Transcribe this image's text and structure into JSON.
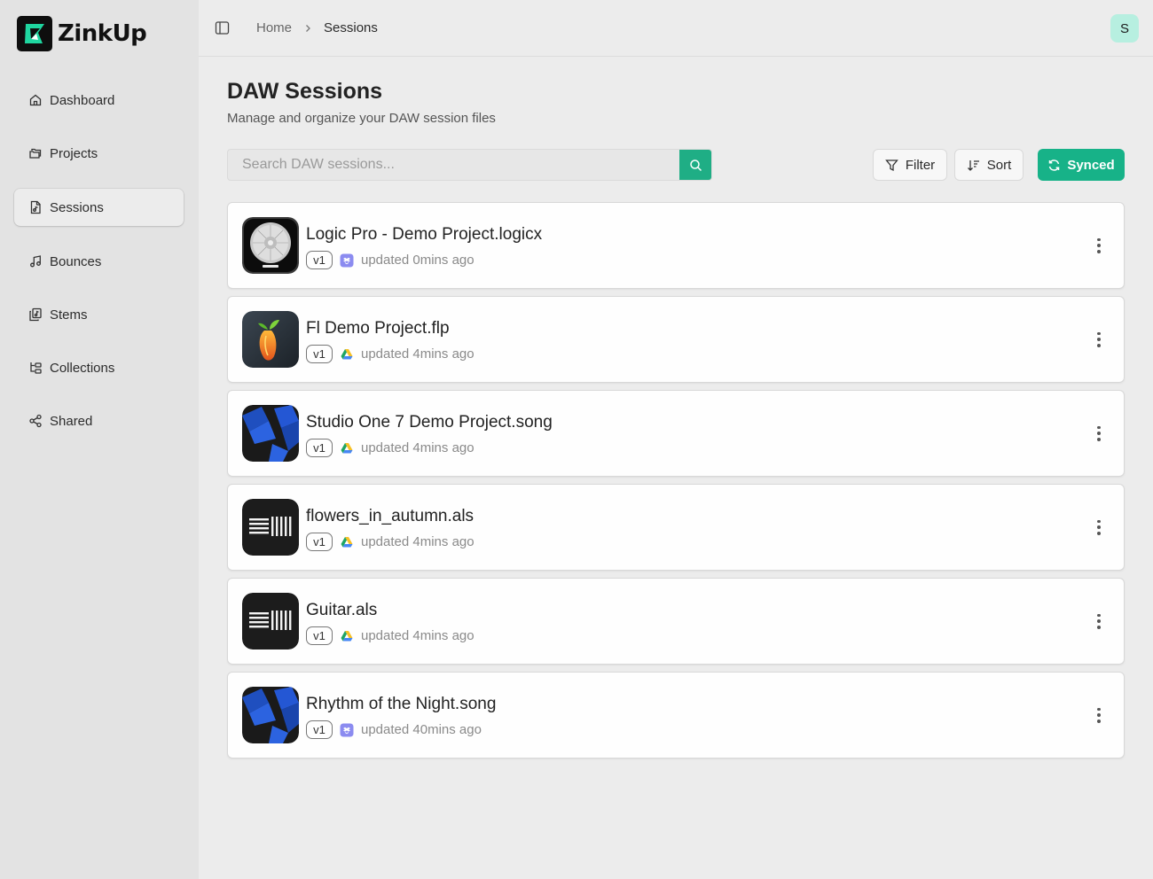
{
  "app": {
    "name": "ZinkUp"
  },
  "sidebar": {
    "items": [
      {
        "label": "Dashboard",
        "icon": "home-icon"
      },
      {
        "label": "Projects",
        "icon": "folders-icon"
      },
      {
        "label": "Sessions",
        "icon": "file-music-icon",
        "active": true
      },
      {
        "label": "Bounces",
        "icon": "music-note-icon"
      },
      {
        "label": "Stems",
        "icon": "copy-music-icon"
      },
      {
        "label": "Collections",
        "icon": "folder-tree-icon"
      },
      {
        "label": "Shared",
        "icon": "share-icon"
      }
    ]
  },
  "header": {
    "breadcrumb": {
      "home": "Home",
      "current": "Sessions"
    },
    "avatar": "S"
  },
  "main": {
    "title": "DAW Sessions",
    "subtitle": "Manage and organize your DAW session files",
    "search": {
      "placeholder": "Search DAW sessions...",
      "value": ""
    },
    "filter_label": "Filter",
    "sort_label": "Sort",
    "synced_label": "Synced"
  },
  "sessions": [
    {
      "name": "Logic Pro - Demo Project.logicx",
      "version": "v1",
      "storage": "dropbox-icon",
      "updated": "updated 0mins ago",
      "app": "logic-pro-icon"
    },
    {
      "name": "Fl Demo Project.flp",
      "version": "v1",
      "storage": "google-drive-icon",
      "updated": "updated 4mins ago",
      "app": "fl-studio-icon"
    },
    {
      "name": "Studio One 7 Demo Project.song",
      "version": "v1",
      "storage": "google-drive-icon",
      "updated": "updated 4mins ago",
      "app": "studio-one-icon"
    },
    {
      "name": "flowers_in_autumn.als",
      "version": "v1",
      "storage": "google-drive-icon",
      "updated": "updated 4mins ago",
      "app": "ableton-icon"
    },
    {
      "name": "Guitar.als",
      "version": "v1",
      "storage": "google-drive-icon",
      "updated": "updated 4mins ago",
      "app": "ableton-icon"
    },
    {
      "name": "Rhythm of the Night.song",
      "version": "v1",
      "storage": "dropbox-icon",
      "updated": "updated 40mins ago",
      "app": "studio-one-icon"
    }
  ],
  "colors": {
    "accent": "#17b288",
    "sidebar_bg": "#e3e3e3",
    "page_bg": "#ececec"
  }
}
